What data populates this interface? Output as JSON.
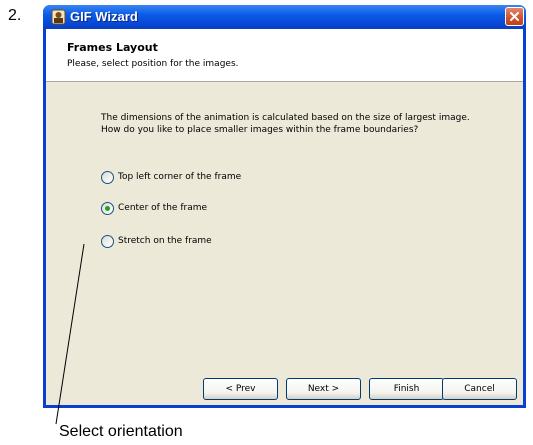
{
  "step_number": "2.",
  "window": {
    "title": "GIF Wizard",
    "app_icon": "gif-wizard-icon",
    "close_icon": "close-icon"
  },
  "header": {
    "title": "Frames Layout",
    "subtitle": "Please, select position for the images."
  },
  "description": {
    "line1": "The dimensions of the animation is calculated based on the size of largest image.",
    "line2": "How do you like to place smaller images within the frame boundaries?"
  },
  "options": [
    {
      "label": "Top left corner of the frame",
      "selected": false
    },
    {
      "label": "Center of the frame",
      "selected": true
    },
    {
      "label": "Stretch on the frame",
      "selected": false
    }
  ],
  "buttons": {
    "prev": "< Prev",
    "next": "Next >",
    "finish": "Finish",
    "cancel": "Cancel"
  },
  "annotation": "Select orientation",
  "colors": {
    "titlebar": "#0b5ce8",
    "dialog_bg": "#ece9d8",
    "close_button": "#d1502c",
    "radio_selected": "#21a121"
  }
}
